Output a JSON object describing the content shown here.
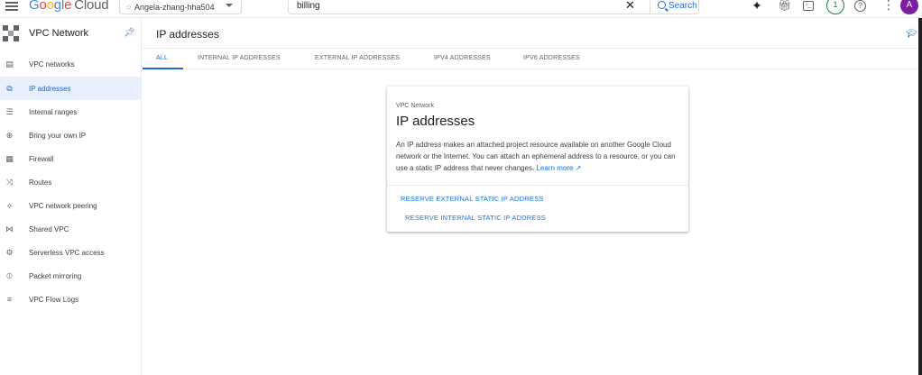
{
  "topbar": {
    "logo_google": "Google",
    "logo_cloud": "Cloud",
    "project_name": "Angela-zhang-hha504",
    "search_value": "billing",
    "search_button": "Search",
    "notifications_count": "1",
    "avatar_initial": "A"
  },
  "sidebar": {
    "title": "VPC Network",
    "items": [
      {
        "label": "VPC networks",
        "icon": "vpc-networks-icon"
      },
      {
        "label": "IP addresses",
        "icon": "ip-addresses-icon",
        "active": true
      },
      {
        "label": "Internal ranges",
        "icon": "internal-ranges-icon"
      },
      {
        "label": "Bring your own IP",
        "icon": "globe-icon"
      },
      {
        "label": "Firewall",
        "icon": "firewall-icon"
      },
      {
        "label": "Routes",
        "icon": "routes-icon"
      },
      {
        "label": "VPC network peering",
        "icon": "peering-icon"
      },
      {
        "label": "Shared VPC",
        "icon": "shared-vpc-icon"
      },
      {
        "label": "Serverless VPC access",
        "icon": "serverless-icon"
      },
      {
        "label": "Packet mirroring",
        "icon": "packet-mirroring-icon"
      },
      {
        "label": "VPC Flow Logs",
        "icon": "flow-logs-icon"
      }
    ]
  },
  "main": {
    "title": "IP addresses",
    "tabs": [
      {
        "label": "ALL",
        "active": true
      },
      {
        "label": "INTERNAL IP ADDRESSES"
      },
      {
        "label": "EXTERNAL IP ADDRESSES"
      },
      {
        "label": "IPV4 ADDRESSES"
      },
      {
        "label": "IPV6 ADDRESSES"
      }
    ],
    "card": {
      "eyebrow": "VPC Network",
      "title": "IP addresses",
      "description": "An IP address makes an attached project resource available on another Google Cloud network or the Internet. You can attach an ephemeral address to a resource, or you can use a static IP address that never changes.",
      "learn_more": "Learn more",
      "action_external": "RESERVE EXTERNAL STATIC IP ADDRESS",
      "action_internal": "RESERVE INTERNAL STATIC IP ADDRESS"
    }
  },
  "colors": {
    "accent": "#1a73e8",
    "active_bg": "#e8f0fe",
    "avatar": "#7b1fa2",
    "badge": "#188038"
  }
}
